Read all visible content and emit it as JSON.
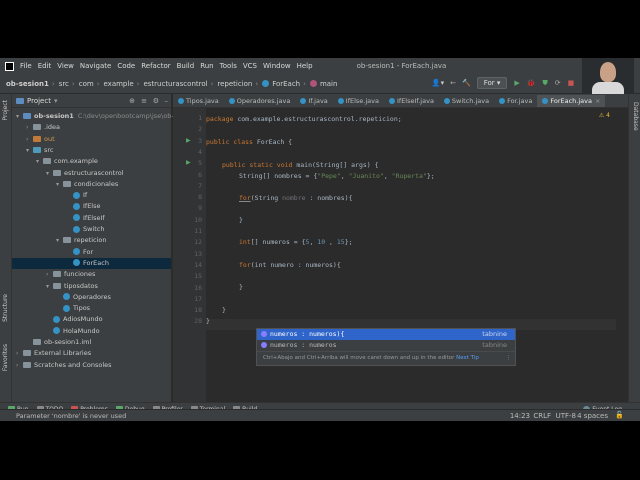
{
  "menu": [
    "File",
    "Edit",
    "View",
    "Navigate",
    "Code",
    "Refactor",
    "Build",
    "Run",
    "Tools",
    "VCS",
    "Window",
    "Help"
  ],
  "window_title": "ob-sesion1 - ForEach.java",
  "breadcrumbs": [
    "ob-sesion1",
    "src",
    "com",
    "example",
    "estructurascontrol",
    "repeticion",
    "ForEach",
    "main"
  ],
  "run_config": "For",
  "project_panel": {
    "title": "Project"
  },
  "tree": [
    {
      "label": "ob-sesion1",
      "extra": "C:\\dev\\openbootcamp\\jse\\ob-se",
      "depth": 0
    },
    {
      "label": ".idea",
      "depth": 1
    },
    {
      "label": "out",
      "depth": 1
    },
    {
      "label": "src",
      "depth": 1
    },
    {
      "label": "com.example",
      "depth": 2
    },
    {
      "label": "estructurascontrol",
      "depth": 3
    },
    {
      "label": "condicionales",
      "depth": 4
    },
    {
      "label": "If",
      "depth": 5
    },
    {
      "label": "IfElse",
      "depth": 5
    },
    {
      "label": "IfElseIf",
      "depth": 5
    },
    {
      "label": "Switch",
      "depth": 5
    },
    {
      "label": "repeticion",
      "depth": 4
    },
    {
      "label": "For",
      "depth": 5
    },
    {
      "label": "ForEach",
      "depth": 5
    },
    {
      "label": "funciones",
      "depth": 3
    },
    {
      "label": "tiposdatos",
      "depth": 3
    },
    {
      "label": "Operadores",
      "depth": 4
    },
    {
      "label": "Tipos",
      "depth": 4
    },
    {
      "label": "AdiosMundo",
      "depth": 3
    },
    {
      "label": "HolaMundo",
      "depth": 3
    },
    {
      "label": "ob-sesion1.iml",
      "depth": 1
    },
    {
      "label": "External Libraries",
      "depth": 0
    },
    {
      "label": "Scratches and Consoles",
      "depth": 0
    }
  ],
  "tabs": [
    "Tipos.java",
    "Operadores.java",
    "If.java",
    "IfElse.java",
    "IfElseIf.java",
    "Switch.java",
    "For.java",
    "ForEach.java"
  ],
  "active_tab": "ForEach.java",
  "warnings": "4",
  "line_numbers": [
    "1",
    "2",
    "3",
    "4",
    "5",
    "6",
    "7",
    "8",
    "9",
    "10",
    "11",
    "12",
    "13",
    "14",
    "15",
    "16",
    "17",
    "18"
  ],
  "line_numbers_tail": [
    "28"
  ],
  "code": {
    "l1": "package com.example.estructurascontrol.repeticion;",
    "l3a": "public class ",
    "l3b": "ForEach {",
    "l5a": "public static void ",
    "l5b": "main(String[] args) {",
    "l6a": "String[] nombres = {",
    "l6s1": "\"Pepe\"",
    "l6s2": "\"Juanito\"",
    "l6s3": "\"Ruperta\"",
    "l6e": "};",
    "l8a": "for",
    "l8b": "(String ",
    "l8c": "nombre",
    "l8d": " : nombres){",
    "l10": "}",
    "l12a": "int",
    "l12b": "[] numeros = {",
    "l12n1": "5",
    "l12n2": "10",
    "l12n3": "15",
    "l12e": "};",
    "l14a": "for",
    "l14b": "(int numero : numeros){",
    "l16": "}",
    "l17": "}",
    "l18": "}"
  },
  "completion": {
    "items": [
      {
        "text": "numeros : numeros){",
        "source": "tabnine"
      },
      {
        "text": "numeros : numeros",
        "source": "tabnine"
      }
    ],
    "hint": "Ctrl+Abajo and Ctrl+Arriba will move caret down and up in the editor",
    "hint_link": "Next Tip"
  },
  "bottom_tools": [
    "Run",
    "TODO",
    "Problems",
    "Debug",
    "Profiler",
    "Terminal",
    "Build"
  ],
  "event_log": "Event Log",
  "status": {
    "message": "Parameter 'nombre' is never used",
    "position": "14:23",
    "line_sep": "CRLF",
    "encoding": "UTF-8",
    "indent": "4 spaces"
  },
  "side_labels": {
    "project": "Project",
    "structure": "Structure",
    "favorites": "Favorites",
    "database": "Database"
  },
  "colors": {
    "keyword": "#cc7832",
    "string": "#6a8759",
    "number": "#6897bb",
    "selection": "#2f65ca"
  }
}
